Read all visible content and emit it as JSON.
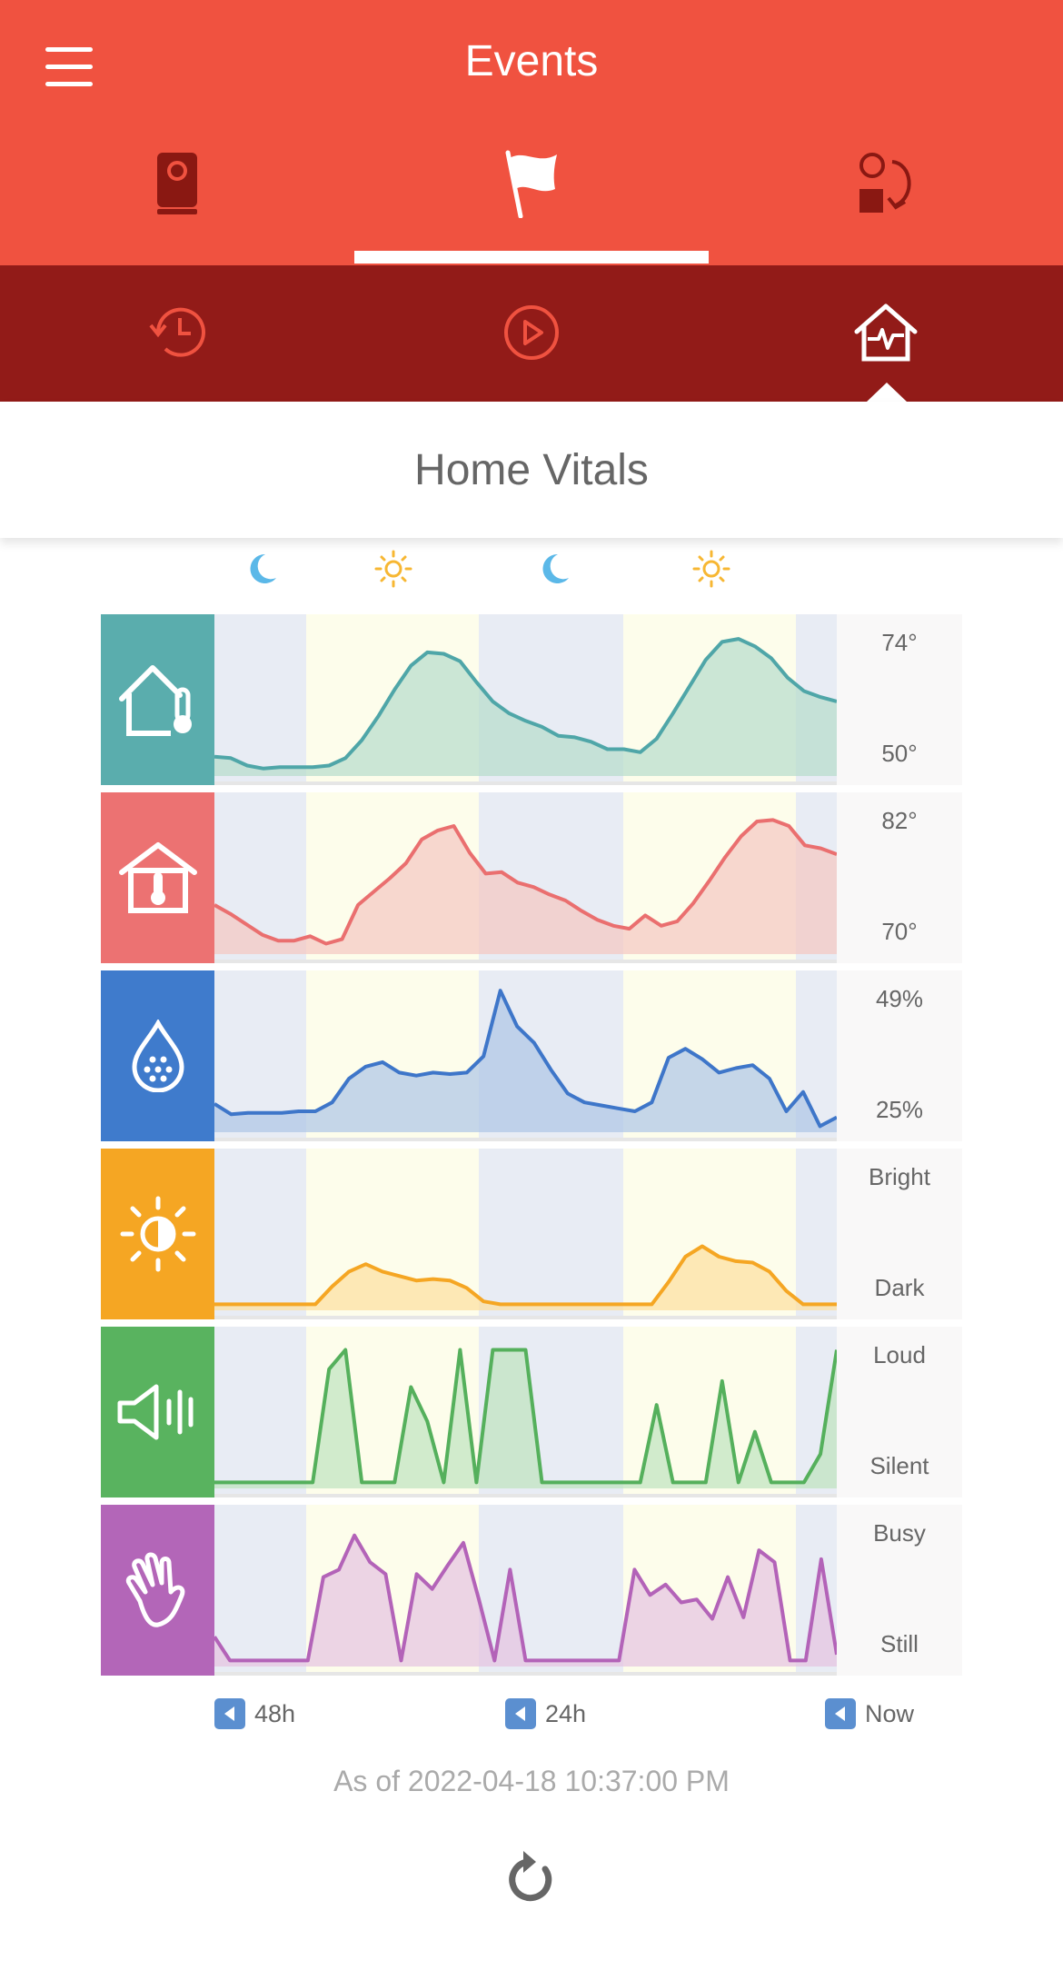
{
  "header": {
    "title": "Events",
    "tabs": [
      {
        "name": "devices",
        "icon": "camera-device-icon"
      },
      {
        "name": "events",
        "icon": "flag-icon",
        "selected": true
      },
      {
        "name": "automations",
        "icon": "automation-icon"
      }
    ]
  },
  "subnav": {
    "tabs": [
      {
        "name": "history",
        "icon": "history-icon"
      },
      {
        "name": "playback",
        "icon": "play-icon"
      },
      {
        "name": "home-vitals",
        "icon": "home-vitals-icon",
        "selected": true
      }
    ]
  },
  "section": {
    "title": "Home Vitals"
  },
  "day_night_markers": [
    "moon",
    "sun",
    "moon",
    "sun"
  ],
  "colors": {
    "topbar": "#f05240",
    "subbar": "#921b18",
    "night_band": "#e8ecf4",
    "day_band": "#fdfdeb",
    "moon": "#5bb8e8",
    "sun": "#f7b733"
  },
  "vitals": [
    {
      "name": "outdoor-temperature",
      "icon": "house-thermometer-outside-icon",
      "color": "#5aadad",
      "stroke": "#4fa6a8",
      "fill": "#b7ddcc",
      "scale_top": "74°",
      "scale_bottom": "50°",
      "values": [
        0.13,
        0.12,
        0.07,
        0.05,
        0.06,
        0.06,
        0.06,
        0.07,
        0.12,
        0.24,
        0.4,
        0.58,
        0.74,
        0.83,
        0.82,
        0.77,
        0.63,
        0.5,
        0.42,
        0.37,
        0.33,
        0.27,
        0.26,
        0.23,
        0.18,
        0.18,
        0.16,
        0.25,
        0.42,
        0.6,
        0.78,
        0.9,
        0.92,
        0.87,
        0.79,
        0.66,
        0.57,
        0.53,
        0.5
      ]
    },
    {
      "name": "indoor-temperature",
      "icon": "house-thermometer-inside-icon",
      "color": "#ec7272",
      "stroke": "#ea6f6f",
      "fill": "#f4c8c2",
      "scale_top": "82°",
      "scale_bottom": "70°",
      "values": [
        0.33,
        0.27,
        0.2,
        0.13,
        0.09,
        0.09,
        0.12,
        0.07,
        0.1,
        0.33,
        0.42,
        0.51,
        0.61,
        0.77,
        0.83,
        0.86,
        0.68,
        0.54,
        0.55,
        0.48,
        0.45,
        0.4,
        0.36,
        0.29,
        0.23,
        0.19,
        0.17,
        0.26,
        0.19,
        0.22,
        0.34,
        0.49,
        0.65,
        0.79,
        0.89,
        0.9,
        0.86,
        0.73,
        0.71,
        0.67
      ]
    },
    {
      "name": "humidity",
      "icon": "humidity-drop-icon",
      "color": "#3f7bcc",
      "stroke": "#3e76c9",
      "fill": "#afc6e6",
      "scale_top": "49%",
      "scale_bottom": "25%",
      "values": [
        0.19,
        0.12,
        0.13,
        0.13,
        0.13,
        0.14,
        0.14,
        0.2,
        0.36,
        0.44,
        0.47,
        0.4,
        0.38,
        0.4,
        0.39,
        0.4,
        0.51,
        0.95,
        0.71,
        0.6,
        0.42,
        0.26,
        0.2,
        0.18,
        0.16,
        0.14,
        0.2,
        0.5,
        0.56,
        0.49,
        0.4,
        0.43,
        0.45,
        0.36,
        0.14,
        0.27,
        0.04,
        0.1
      ]
    },
    {
      "name": "light-level",
      "icon": "brightness-icon",
      "color": "#f5a623",
      "stroke": "#f5a623",
      "fill": "#fcdfa0",
      "scale_top": "Bright",
      "scale_bottom": "Dark",
      "values": [
        0.04,
        0.04,
        0.04,
        0.04,
        0.04,
        0.04,
        0.04,
        0.16,
        0.26,
        0.31,
        0.26,
        0.23,
        0.2,
        0.21,
        0.2,
        0.15,
        0.06,
        0.04,
        0.04,
        0.04,
        0.04,
        0.04,
        0.04,
        0.04,
        0.04,
        0.04,
        0.04,
        0.19,
        0.36,
        0.43,
        0.36,
        0.33,
        0.32,
        0.26,
        0.13,
        0.04,
        0.04,
        0.04
      ]
    },
    {
      "name": "noise-level",
      "icon": "speaker-volume-icon",
      "color": "#59b35f",
      "stroke": "#55b05c",
      "fill": "#bfe3bf",
      "scale_top": "Loud",
      "scale_bottom": "Silent",
      "values": [
        0.04,
        0.04,
        0.04,
        0.04,
        0.04,
        0.04,
        0.04,
        0.8,
        0.93,
        0.04,
        0.04,
        0.04,
        0.68,
        0.45,
        0.04,
        0.93,
        0.04,
        0.93,
        0.93,
        0.93,
        0.04,
        0.04,
        0.04,
        0.04,
        0.04,
        0.04,
        0.04,
        0.56,
        0.04,
        0.04,
        0.04,
        0.72,
        0.04,
        0.38,
        0.04,
        0.04,
        0.04,
        0.23,
        0.93
      ]
    },
    {
      "name": "activity",
      "icon": "waving-hand-icon",
      "color": "#b366b8",
      "stroke": "#b363b8",
      "fill": "#e5c4e0",
      "scale_top": "Busy",
      "scale_bottom": "Still",
      "values": [
        0.2,
        0.04,
        0.04,
        0.04,
        0.04,
        0.04,
        0.04,
        0.6,
        0.65,
        0.88,
        0.7,
        0.62,
        0.04,
        0.62,
        0.52,
        0.68,
        0.83,
        0.45,
        0.04,
        0.65,
        0.04,
        0.04,
        0.04,
        0.04,
        0.04,
        0.04,
        0.04,
        0.65,
        0.48,
        0.55,
        0.43,
        0.45,
        0.32,
        0.6,
        0.33,
        0.78,
        0.7,
        0.04,
        0.04,
        0.72,
        0.08
      ]
    }
  ],
  "timeline": [
    {
      "label": "48h",
      "icon": "play-back-icon"
    },
    {
      "label": "24h",
      "icon": "play-back-icon"
    },
    {
      "label": "Now",
      "icon": "play-back-icon"
    }
  ],
  "as_of": "As of 2022-04-18 10:37:00 PM",
  "refresh_icon": "refresh-icon"
}
